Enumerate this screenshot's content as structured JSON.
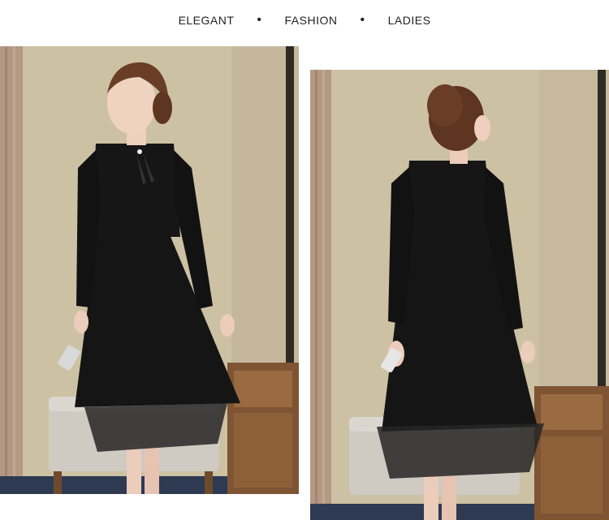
{
  "tagline": {
    "words": [
      "ELEGANT",
      "FASHION",
      "LADIES"
    ],
    "separator": "•"
  },
  "photos": [
    {
      "name": "front-view",
      "icon": "model-front-photo",
      "subject": "woman in black long-sleeve dress, front"
    },
    {
      "name": "back-view",
      "icon": "model-back-photo",
      "subject": "woman in black long-sleeve dress, back"
    }
  ],
  "colors": {
    "wall": "#cfc3a7",
    "curtain": "#b59a86",
    "dress": "#161616",
    "skin": "#efcfbd",
    "wood": "#8a5a33",
    "ottoman": "#cfcbc4"
  }
}
